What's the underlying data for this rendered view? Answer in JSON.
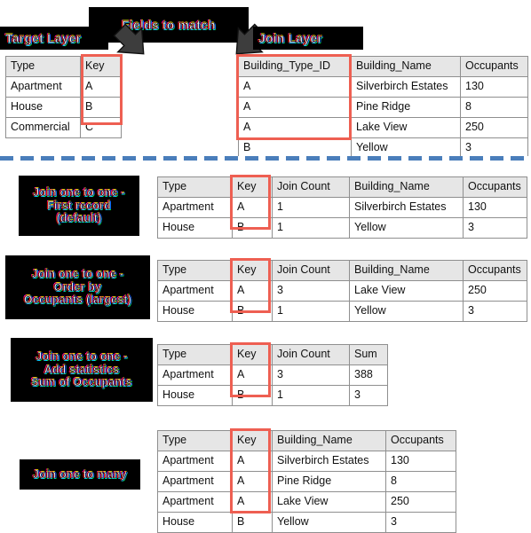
{
  "colors": {
    "highlight": "#ee5f52",
    "divider": "#4a7ebb",
    "header_bg": "#e6e6e6",
    "plate_bg": "#000000",
    "arrow": "#3d3d3d"
  },
  "diagram": {
    "top": {
      "fields_to_match_label": "Fields to match",
      "target_layer_label": "Target Layer",
      "join_layer_label": "Join Layer",
      "target_table": {
        "columns": [
          "Type",
          "Key"
        ],
        "rows": [
          [
            "Apartment",
            "A"
          ],
          [
            "House",
            "B"
          ],
          [
            "Commercial",
            "C"
          ]
        ],
        "highlighted_column": "Key"
      },
      "join_table": {
        "columns": [
          "Building_Type_ID",
          "Building_Name",
          "Occupants"
        ],
        "rows": [
          [
            "A",
            "Silverbirch Estates",
            "130"
          ],
          [
            "A",
            "Pine Ridge",
            "8"
          ],
          [
            "A",
            "Lake View",
            "250"
          ],
          [
            "B",
            "Yellow",
            "3"
          ]
        ],
        "highlighted_column": "Building_Type_ID"
      }
    },
    "results": [
      {
        "label_lines": [
          "Join one to one -",
          "First record",
          "(default)"
        ],
        "columns": [
          "Type",
          "Key",
          "Join Count",
          "Building_Name",
          "Occupants"
        ],
        "rows": [
          [
            "Apartment",
            "A",
            "1",
            "Silverbirch Estates",
            "130"
          ],
          [
            "House",
            "B",
            "1",
            "Yellow",
            "3"
          ]
        ],
        "highlighted_column": "Key"
      },
      {
        "label_lines": [
          "Join one to one -",
          "Order by",
          "Occupants (largest)"
        ],
        "columns": [
          "Type",
          "Key",
          "Join Count",
          "Building_Name",
          "Occupants"
        ],
        "rows": [
          [
            "Apartment",
            "A",
            "3",
            "Lake View",
            "250"
          ],
          [
            "House",
            "B",
            "1",
            "Yellow",
            "3"
          ]
        ],
        "highlighted_column": "Key"
      },
      {
        "label_lines": [
          "Join one to one -",
          "Add statistics",
          "Sum of Occupants"
        ],
        "columns": [
          "Type",
          "Key",
          "Join Count",
          "Sum"
        ],
        "rows": [
          [
            "Apartment",
            "A",
            "3",
            "388"
          ],
          [
            "House",
            "B",
            "1",
            "3"
          ]
        ],
        "highlighted_column": "Key"
      },
      {
        "label_lines": [
          "Join one to many"
        ],
        "columns": [
          "Type",
          "Key",
          "Building_Name",
          "Occupants"
        ],
        "rows": [
          [
            "Apartment",
            "A",
            "Silverbirch Estates",
            "130"
          ],
          [
            "Apartment",
            "A",
            "Pine Ridge",
            "8"
          ],
          [
            "Apartment",
            "A",
            "Lake View",
            "250"
          ],
          [
            "House",
            "B",
            "Yellow",
            "3"
          ]
        ],
        "highlighted_column": "Key"
      }
    ]
  }
}
